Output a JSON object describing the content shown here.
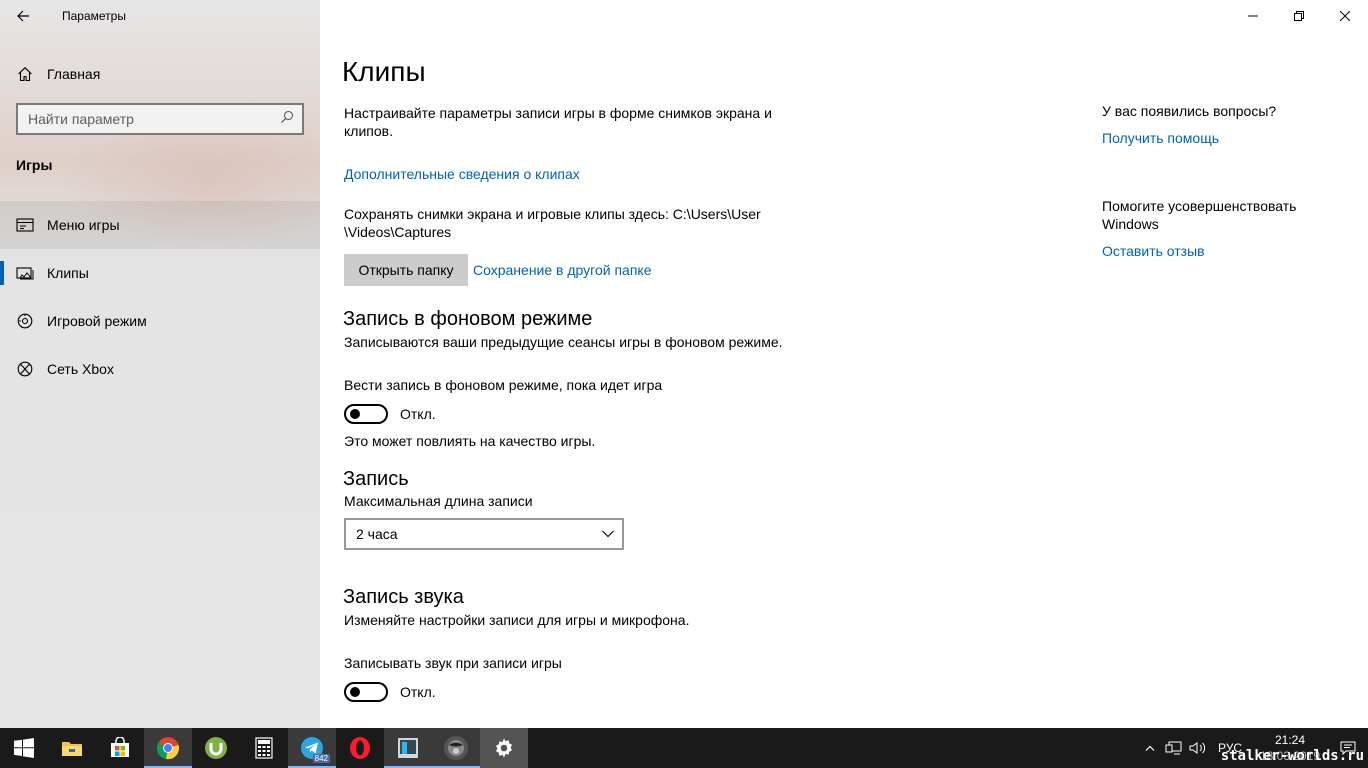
{
  "window": {
    "app_title": "Параметры",
    "controls": [
      "minimize",
      "restore",
      "close"
    ]
  },
  "sidebar": {
    "home_label": "Главная",
    "search_placeholder": "Найти параметр",
    "section_title": "Игры",
    "items": [
      {
        "label": "Меню игры",
        "icon": "game-menu-icon",
        "state": "hover"
      },
      {
        "label": "Клипы",
        "icon": "clips-icon",
        "state": "selected"
      },
      {
        "label": "Игровой режим",
        "icon": "game-mode-icon",
        "state": ""
      },
      {
        "label": "Сеть Xbox",
        "icon": "xbox-icon",
        "state": ""
      }
    ]
  },
  "main": {
    "title": "Клипы",
    "intro_line1": "Настраивайте параметры записи игры в форме снимков экрана и",
    "intro_line2": "клипов.",
    "more_info_link": "Дополнительные сведения о клипах",
    "save_path_line1": "Сохранять снимки экрана и игровые клипы здесь: C:\\Users\\User",
    "save_path_line2": "\\Videos\\Captures",
    "open_folder_button": "Открыть папку",
    "save_elsewhere_link": "Сохранение в другой папке",
    "background": {
      "heading": "Запись в фоновом режиме",
      "description": "Записываются ваши предыдущие сеансы игры в фоновом режиме.",
      "toggle_label": "Вести запись в фоновом режиме, пока идет игра",
      "toggle_state": "Откл.",
      "note": "Это может повлиять на качество игры."
    },
    "recording": {
      "heading": "Запись",
      "max_length_label": "Максимальная длина записи",
      "max_length_value": "2 часа"
    },
    "audio": {
      "heading": "Запись звука",
      "description": "Изменяйте настройки записи для игры и микрофона.",
      "toggle_label": "Записывать звук при записи игры",
      "toggle_state": "Откл."
    }
  },
  "help_panel": {
    "question": "У вас появились вопросы?",
    "get_help_link": "Получить помощь",
    "improve_line1": "Помогите усовершенствовать",
    "improve_line2": "Windows",
    "feedback_link": "Оставить отзыв"
  },
  "taskbar": {
    "apps": [
      "start-icon",
      "file-explorer-icon",
      "store-icon",
      "chrome-icon",
      "utorrent-icon",
      "calculator-icon",
      "telegram-icon",
      "opera-icon",
      "app-icon",
      "game-icon",
      "settings-icon"
    ],
    "telegram_badge": "842",
    "language": "РУС",
    "time": "21:24",
    "date": "18.03.2019"
  },
  "watermark": "stalker-worlds.ru",
  "colors": {
    "accent": "#0063b1",
    "taskbar_bg": "#1a1a1a",
    "sidebar_bg": "#e6e6e6"
  }
}
